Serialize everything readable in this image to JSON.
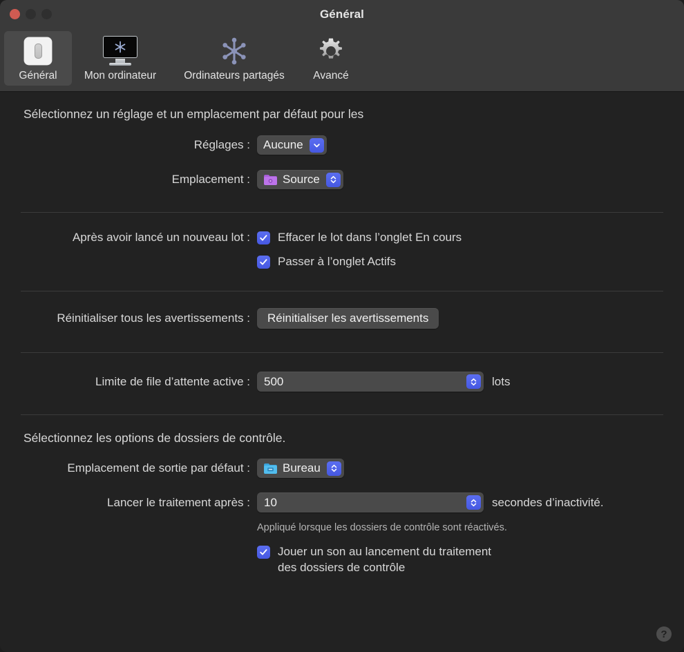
{
  "window": {
    "title": "Général",
    "traffic": {
      "close": "close-button",
      "minimize": "minimize-button",
      "zoom": "zoom-button"
    }
  },
  "toolbar": {
    "tabs": [
      {
        "label": "Général",
        "icon": "toggle-switch-icon",
        "selected": true
      },
      {
        "label": "Mon ordinateur",
        "icon": "monitor-icon",
        "selected": false
      },
      {
        "label": "Ordinateurs partagés",
        "icon": "network-nodes-icon",
        "selected": false
      },
      {
        "label": "Avancé",
        "icon": "gear-icon",
        "selected": false
      }
    ]
  },
  "sections": {
    "defaults": {
      "heading": "Sélectionnez un réglage et un emplacement par défaut pour les",
      "settings_label": "Réglages :",
      "settings_value": "Aucune",
      "location_label": "Emplacement :",
      "location_value": "Source",
      "location_icon": "purple-folder-icon"
    },
    "after_batch": {
      "label": "Après avoir lancé un nouveau lot :",
      "checkboxes": [
        {
          "label": "Effacer le lot dans l’onglet En cours",
          "checked": true
        },
        {
          "label": "Passer à l’onglet Actifs",
          "checked": true
        }
      ]
    },
    "reset": {
      "label": "Réinitialiser tous les avertissements :",
      "button": "Réinitialiser les avertissements"
    },
    "queue": {
      "label": "Limite de file d’attente active :",
      "value": "500",
      "suffix": "lots"
    },
    "watch_folders": {
      "heading": "Sélectionnez les options de dossiers de contrôle.",
      "output_label": "Emplacement de sortie par défaut :",
      "output_value": "Bureau",
      "output_icon": "blue-desktop-folder-icon",
      "delay_label": "Lancer le traitement après :",
      "delay_value": "10",
      "delay_suffix": "secondes d’inactivité.",
      "note": "Appliqué lorsque les dossiers de contrôle sont réactivés.",
      "sound_checkbox": {
        "line1": "Jouer un son au lancement du traitement",
        "line2": "des dossiers de contrôle",
        "checked": true
      }
    }
  },
  "help": {
    "glyph": "?"
  },
  "colors": {
    "accent": "#4c5ee6",
    "toolbar_bg": "#3a3a3a",
    "content_bg": "#222222",
    "control_bg": "#4a4a4a",
    "close_light": "#cf5b52"
  }
}
